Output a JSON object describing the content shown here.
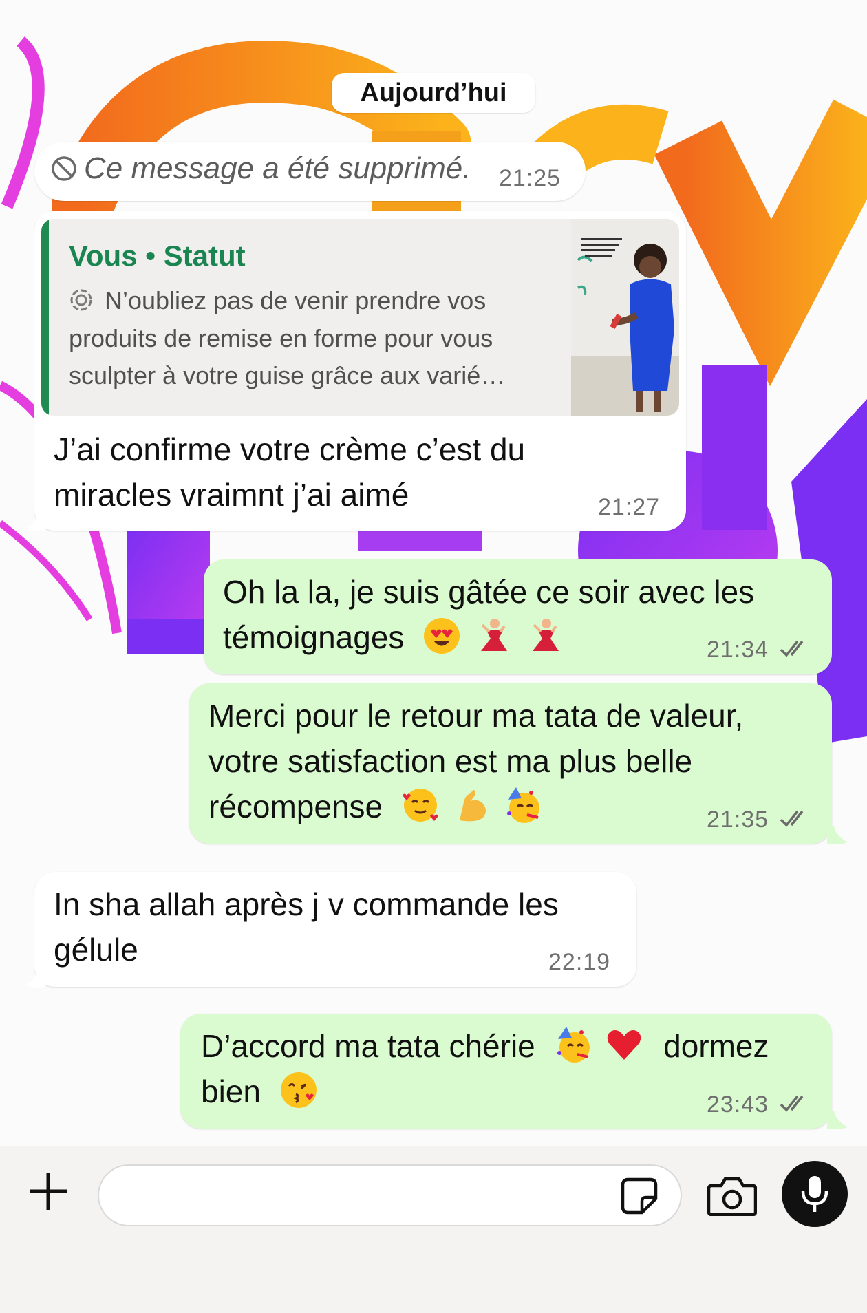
{
  "chat": {
    "date_separator": "Aujourd’hui",
    "messages": [
      {
        "direction": "incoming",
        "deleted": true,
        "text": "Ce message a été supprimé.",
        "time": "21:25",
        "icon": "prohibited-icon"
      },
      {
        "direction": "incoming",
        "reply_to": {
          "author": "Vous • Statut",
          "preview_lines": [
            "N’oubliez pas de venir prendre vos",
            "produits de remise en forme pour vous",
            "sculpter à votre guise grâce aux varié…"
          ],
          "icon": "status-ring-icon",
          "thumbnail": "woman-blue-dress-photo"
        },
        "lines": [
          "J’ai confirme votre crème c’est du",
          "miracles vraimnt j’ai aimé"
        ],
        "time": "21:27"
      },
      {
        "direction": "outgoing",
        "lines": [
          "Oh la la, je suis gâtée ce soir avec les",
          "témoignages"
        ],
        "emojis": [
          "heart-eyes-emoji",
          "dancer-emoji",
          "dancer-emoji"
        ],
        "time": "21:34",
        "status": "read"
      },
      {
        "direction": "outgoing",
        "lines": [
          "Merci pour le retour ma tata de valeur,",
          "votre satisfaction est ma plus belle",
          "récompense"
        ],
        "emojis": [
          "smiling-hearts-emoji",
          "flexed-biceps-emoji",
          "partying-face-emoji"
        ],
        "time": "21:35",
        "status": "read"
      },
      {
        "direction": "incoming",
        "lines": [
          "In sha allah après j v commande les",
          "gélule"
        ],
        "time": "22:19"
      },
      {
        "direction": "outgoing",
        "lines": [
          "D’accord ma tata chérie",
          "dormez",
          "bien"
        ],
        "emojis": [
          "partying-face-emoji",
          "red-heart-emoji",
          "kissing-heart-emoji"
        ],
        "time": "23:43",
        "status": "read"
      }
    ]
  },
  "composer": {
    "placeholder": "",
    "value": "",
    "buttons": [
      "plus-icon",
      "sticker-icon",
      "camera-icon",
      "microphone-icon"
    ]
  },
  "colors": {
    "incoming_bubble": "#ffffff",
    "outgoing_bubble": "#dafbd0",
    "accent": "#1f8a52",
    "mic_button": "#111111"
  }
}
